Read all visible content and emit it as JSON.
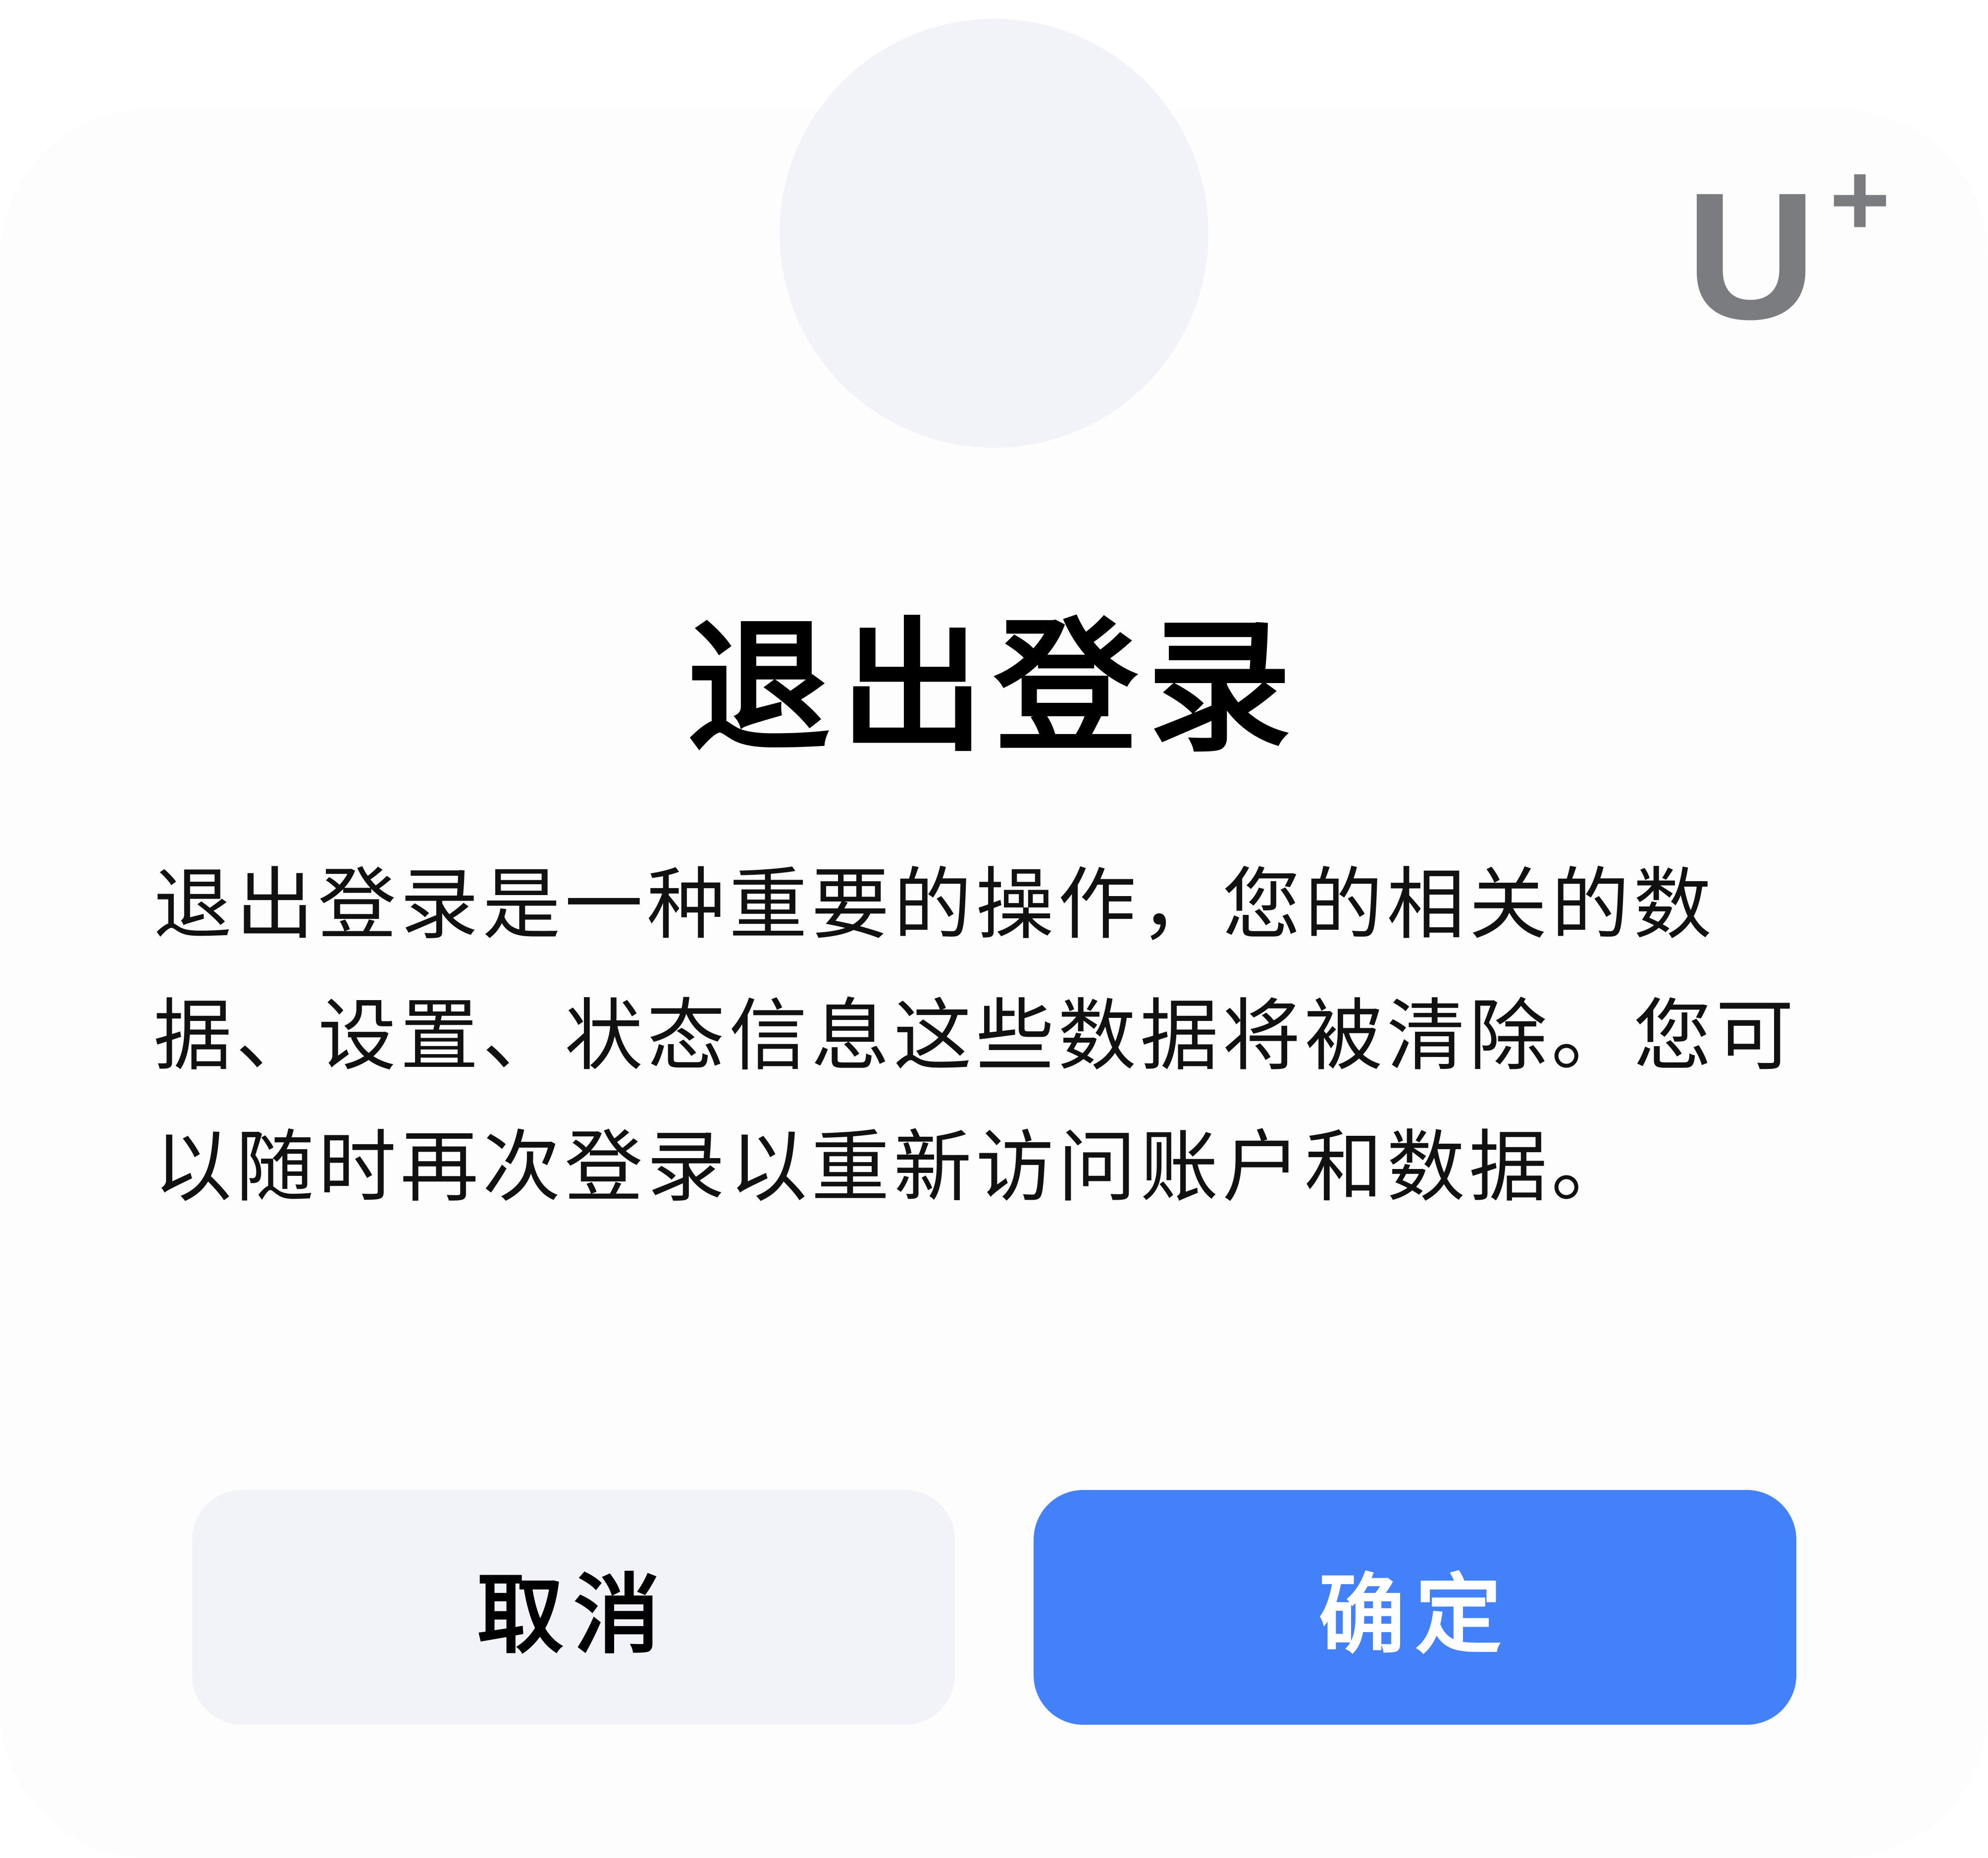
{
  "dialog": {
    "logo": {
      "letter": "U",
      "superscript": "+"
    },
    "title": "退出登录",
    "message": "退出登录是一种重要的操作，您的相关的数据、设置、状态信息这些数据将被清除。您可以随时再次登录以重新访问账户和数据。",
    "buttons": {
      "cancel_label": "取消",
      "confirm_label": "确定"
    },
    "colors": {
      "confirm_background": "#4281fa",
      "cancel_background": "#f1f3f8",
      "avatar_background": "#f1f3f8",
      "logo_color": "#7b7c7f"
    }
  }
}
